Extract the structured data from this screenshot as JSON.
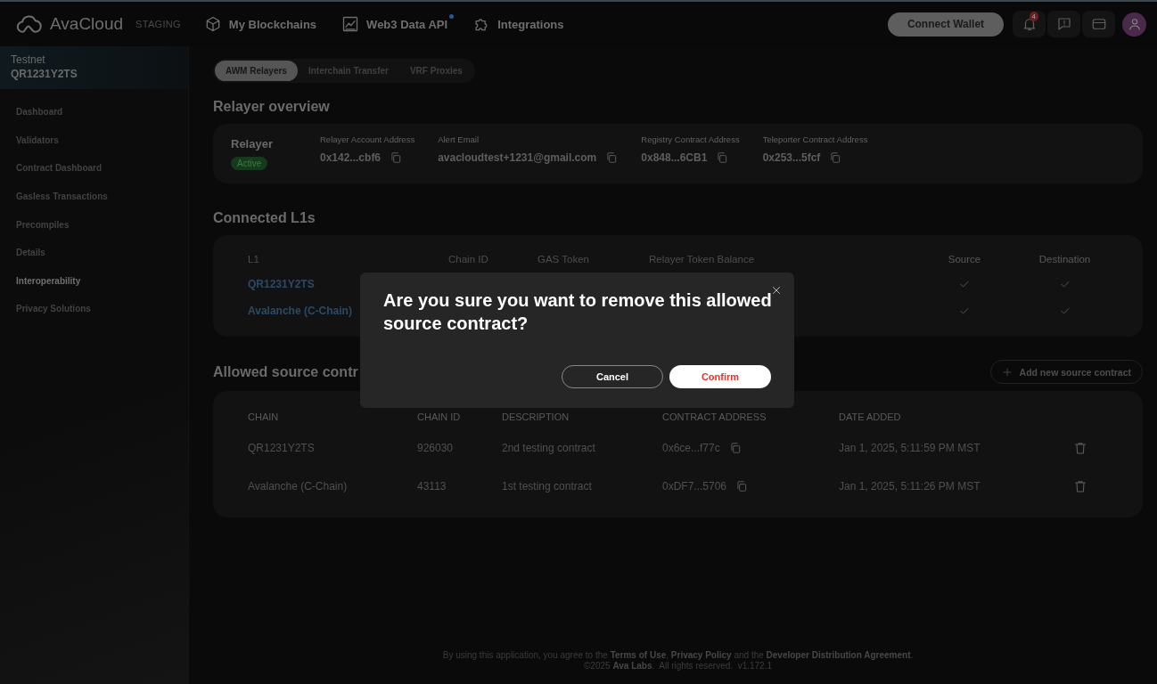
{
  "header": {
    "logo_text": "AvaCloud",
    "environment": "STAGING",
    "nav": [
      {
        "label": "My Blockchains",
        "kind": "cube",
        "dot": false
      },
      {
        "label": "Web3 Data API",
        "kind": "chart",
        "dot": true
      },
      {
        "label": "Integrations",
        "kind": "puzzle",
        "dot": false
      }
    ],
    "connect_button": "Connect Wallet",
    "notification_count": "4"
  },
  "sidebar": {
    "network": "Testnet",
    "chain": "QR1231Y2TS",
    "items": [
      {
        "label": "Dashboard",
        "selected": false
      },
      {
        "label": "Validators",
        "selected": false
      },
      {
        "label": "Contract Dashboard",
        "selected": false
      },
      {
        "label": "Gasless Transactions",
        "selected": false
      },
      {
        "label": "Precompiles",
        "selected": false
      },
      {
        "label": "Details",
        "selected": false
      },
      {
        "label": "Interoperability",
        "selected": true
      },
      {
        "label": "Privacy Solutions",
        "selected": false
      }
    ]
  },
  "tabs": [
    {
      "label": "AWM Relayers",
      "selected": true
    },
    {
      "label": "Interchain Transfer",
      "selected": false
    },
    {
      "label": "VRF Proxies",
      "selected": false
    }
  ],
  "relayer_overview": {
    "title": "Relayer overview",
    "name": "Relayer",
    "status": "Active",
    "fields": [
      {
        "label": "Relayer Account Address",
        "value": "0x142...cbf6"
      },
      {
        "label": "Alert Email",
        "value": "avacloudtest+1231@gmail.com"
      },
      {
        "label": "Registry Contract Address",
        "value": "0x848...6CB1"
      },
      {
        "label": "Teleporter Contract Address",
        "value": "0x253...5fcf"
      }
    ]
  },
  "connected_l1s": {
    "title": "Connected L1s",
    "columns": [
      "L1",
      "Chain ID",
      "GAS Token",
      "Relayer Token Balance",
      "Source",
      "Destination"
    ],
    "rows": [
      {
        "l1": "QR1231Y2TS",
        "source": true,
        "destination": true
      },
      {
        "l1": "Avalanche (C-Chain)",
        "source": true,
        "destination": true
      }
    ]
  },
  "allowed_source_contracts": {
    "title": "Allowed source contr",
    "add_button": "Add new source contract",
    "columns": [
      "CHAIN",
      "CHAIN ID",
      "DESCRIPTION",
      "CONTRACT ADDRESS",
      "DATE ADDED"
    ],
    "rows": [
      {
        "chain": "QR1231Y2TS",
        "chain_id": "926030",
        "description": "2nd testing contract",
        "address": "0x6ce...f77c",
        "date": "Jan 1, 2025, 5:11:59 PM MST"
      },
      {
        "chain": "Avalanche (C-Chain)",
        "chain_id": "43113",
        "description": "1st testing contract",
        "address": "0xDF7...5706",
        "date": "Jan 1, 2025, 5:11:26 PM MST"
      }
    ]
  },
  "modal": {
    "question": "Are you sure you want to remove this allowed source contract?",
    "cancel": "Cancel",
    "confirm": "Confirm"
  },
  "footer": {
    "notice": "By using this application, you agree to the **Terms of Use**, **Privacy Policy** and the **Developer Distribution Agreement**.",
    "copyright": "©2025 **Ava Labs**.  All rights reserved.  v1.172.1"
  }
}
